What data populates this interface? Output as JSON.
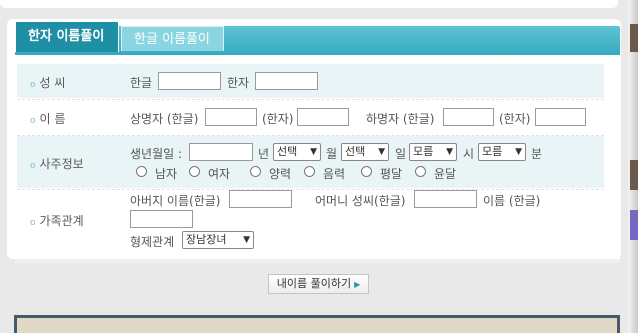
{
  "tabs": [
    {
      "label": "한자 이름풀이",
      "active": true
    },
    {
      "label": "한글 이름풀이",
      "active": false
    }
  ],
  "rows": {
    "surname": {
      "label": "성 씨",
      "hangul_label": "한글",
      "hanja_label": "한자"
    },
    "name": {
      "label": "이 름",
      "upper_label": "상명자 (한글)",
      "upper_hanja_label": "(한자)",
      "lower_label": "하명자 (한글)",
      "lower_hanja_label": "(한자)"
    },
    "saju": {
      "label": "사주정보",
      "birth_label": "생년월일 :",
      "year_label": "년",
      "month_select": "선택",
      "month_label": "월",
      "day_select": "선택",
      "day_label": "일",
      "hour_select": "모름",
      "hour_label": "시",
      "minute_select": "모름",
      "minute_label": "분",
      "gender_male": "남자",
      "gender_female": "여자",
      "cal_solar": "양력",
      "cal_lunar": "음력",
      "cal_normal": "평달",
      "cal_leap": "윤달"
    },
    "family": {
      "label": "가족관계",
      "father_label": "아버지 이름(한글)",
      "mother_label": "어머니 성씨(한글)",
      "mother_name_label": "이름 (한글)",
      "sibling_label": "형제관계",
      "sibling_select": "장남장녀"
    }
  },
  "submit_label": "내이름 풀이하기",
  "colors": {
    "tab_bar": "#36a9bf",
    "tab_active": "#1f8fa5",
    "row_shade": "#e8f4f6",
    "bullet": "#7cc0cc"
  }
}
